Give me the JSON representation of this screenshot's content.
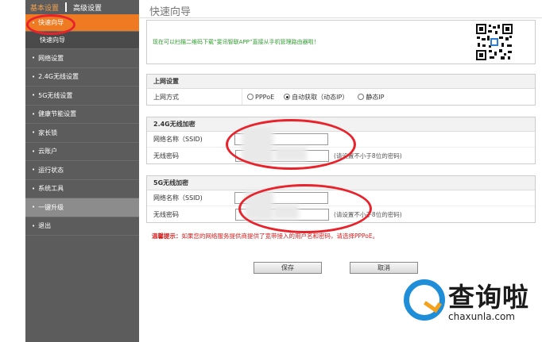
{
  "sidebar": {
    "tabs": [
      "基本设置",
      "高级设置"
    ],
    "items": [
      {
        "label": "快速向导",
        "state": "active"
      },
      {
        "label": "快速向导",
        "state": "sub"
      },
      {
        "label": "网络设置",
        "state": "normal"
      },
      {
        "label": "2.4G无线设置",
        "state": "normal"
      },
      {
        "label": "5G无线设置",
        "state": "normal"
      },
      {
        "label": "健康节能设置",
        "state": "normal"
      },
      {
        "label": "家长锁",
        "state": "normal"
      },
      {
        "label": "云账户",
        "state": "normal"
      },
      {
        "label": "运行状态",
        "state": "normal"
      },
      {
        "label": "系统工具",
        "state": "normal"
      },
      {
        "label": "一键升级",
        "state": "grey"
      },
      {
        "label": "退出",
        "state": "normal"
      }
    ]
  },
  "main": {
    "title": "快速向导",
    "qr_text": "现在可以扫描二维码下载“斐讯智联APP”直接从手机管理路由器啦！",
    "internet": {
      "heading": "上网设置",
      "label": "上网方式",
      "options": [
        "PPPoE",
        "自动获取（动态IP）",
        "静态IP"
      ],
      "selected": "自动获取（动态IP）"
    },
    "wifi24": {
      "heading": "2.4G无线加密",
      "ssid_label": "网络名称（SSID)",
      "pwd_label": "无线密码",
      "hint": "(请设置不小于8位的密码)"
    },
    "wifi5": {
      "heading": "5G无线加密",
      "ssid_label": "网络名称（SSID)",
      "pwd_label": "无线密码",
      "hint": "(请设置不小于8位的密码)"
    },
    "tip_prefix": "温馨提示：",
    "tip_text": "如果您的网络服务提供商提供了宽带接入的用户名和密码，请选择PPPoE。",
    "save_label": "保存",
    "cancel_label": "取消"
  },
  "watermark": {
    "cn": "查询啦",
    "en": "chaxunla.com"
  },
  "colors": {
    "accent": "#ee7b22",
    "sidebar": "#5c5c5c",
    "annotation": "#e8232b",
    "tip": "#d42020"
  }
}
